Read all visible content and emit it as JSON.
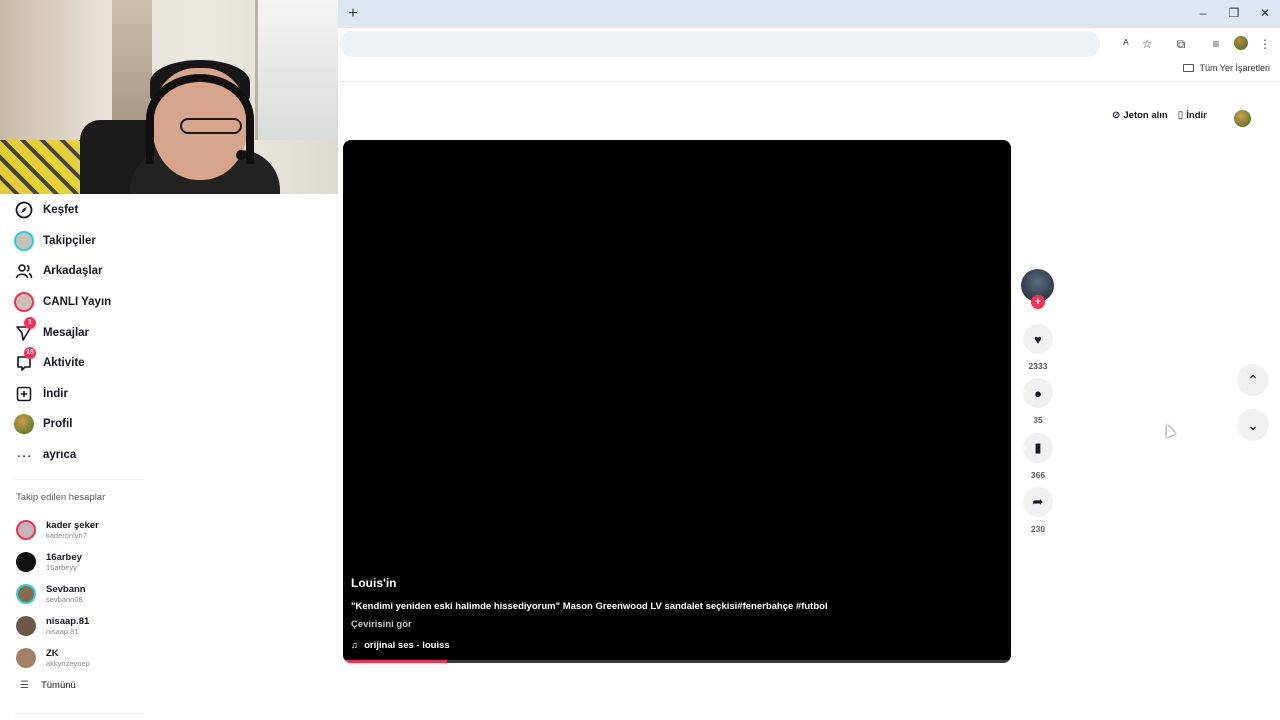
{
  "browser": {
    "new_tab": "+",
    "bookmarks_all": "Tüm Yer İşaretleri",
    "window_controls": [
      "–",
      "❐",
      "✕"
    ]
  },
  "sidebar": {
    "items": [
      {
        "label": "Keşfet",
        "icon": "compass-icon"
      },
      {
        "label": "Takipçiler",
        "icon": "avatar"
      },
      {
        "label": "Arkadaşlar",
        "icon": "friends-icon"
      },
      {
        "label": "CANLI Yayın",
        "icon": "avatar-live"
      },
      {
        "label": "Mesajlar",
        "icon": "send-icon",
        "badge": "1"
      },
      {
        "label": "Aktivite",
        "icon": "inbox-icon",
        "badge": "15"
      },
      {
        "label": "İndir",
        "icon": "plus-square-icon"
      },
      {
        "label": "Profil",
        "icon": "avatar-profile"
      },
      {
        "label": "ayrıca",
        "icon": "more-icon"
      }
    ],
    "following_heading": "Takip edilen hesaplar",
    "following": [
      {
        "name": "kader şeker",
        "username": "kaderonlyn7"
      },
      {
        "name": "16arbey",
        "username": "16arbeyy"
      },
      {
        "name": "Sevbann",
        "username": "sevbann08"
      },
      {
        "name": "nisaap.81",
        "username": "nisaap.81"
      },
      {
        "name": "ZK",
        "username": "akkynzeynep"
      }
    ],
    "see_all": "Tümünü"
  },
  "top_actions": {
    "coins": "Jeton alın",
    "download": "İndir"
  },
  "video": {
    "author": "Louis'in",
    "caption": "\"Kendimi yeniden eski halimde hissediyorum\" Mason Greenwood LV sandalet seçkisi#fenerbahçe #futbol",
    "translate": "Çevirisini gör",
    "sound": "orijinal ses - louiss",
    "progress": 0.155
  },
  "actions": {
    "likes": "2333",
    "comments": "35",
    "saves": "366",
    "shares": "230"
  },
  "colors": {
    "accent": "#fe2c55",
    "ring": "#20d5ec"
  }
}
